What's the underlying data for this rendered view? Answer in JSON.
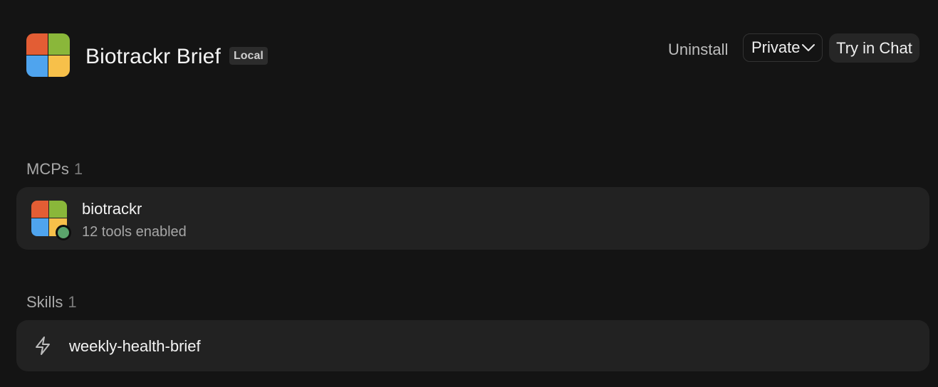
{
  "header": {
    "title": "Biotrackr Brief",
    "badge": "Local",
    "uninstall_label": "Uninstall",
    "visibility": {
      "selected": "Private"
    },
    "try_label": "Try in Chat",
    "logo_icon": "four-square-logo-icon"
  },
  "colors": {
    "background": "#141414",
    "card": "#222222",
    "logo_red": "#e35d34",
    "logo_green": "#8ab73a",
    "logo_blue": "#4fa4ee",
    "logo_yellow": "#f7c04a",
    "status_online": "#5aa36b"
  },
  "mcps": {
    "heading": "MCPs",
    "count": "1",
    "items": [
      {
        "name": "biotrackr",
        "subtitle": "12 tools enabled",
        "status": "enabled"
      }
    ]
  },
  "skills": {
    "heading": "Skills",
    "count": "1",
    "items": [
      {
        "name": "weekly-health-brief",
        "icon": "bolt-icon"
      }
    ]
  }
}
